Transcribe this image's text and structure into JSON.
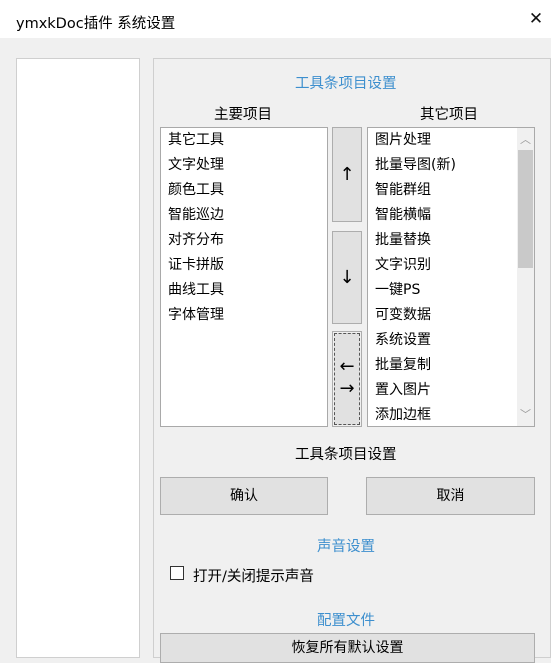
{
  "window": {
    "title": "ymxkDoc插件 系统设置",
    "close_glyph": "✕"
  },
  "toolbar_section": {
    "heading": "工具条项目设置",
    "main_header": "主要项目",
    "other_header": "其它项目",
    "main_items": [
      "其它工具",
      "文字处理",
      "颜色工具",
      "智能巡边",
      "对齐分布",
      "证卡拼版",
      "曲线工具",
      "字体管理"
    ],
    "other_items": [
      "图片处理",
      "批量导图(新)",
      "智能群组",
      "智能横幅",
      "批量替换",
      "文字识别",
      "一键PS",
      "可变数据",
      "系统设置",
      "批量复制",
      "置入图片",
      "添加边框"
    ],
    "up_glyph": "↑",
    "down_glyph": "↓",
    "swap_glyph_left": "←",
    "swap_glyph_right": "→",
    "footer_label": "工具条项目设置",
    "confirm_label": "确认",
    "cancel_label": "取消"
  },
  "sound_section": {
    "heading": "声音设置",
    "checkbox_label": "打开/关闭提示声音",
    "checked": false
  },
  "config_section": {
    "heading": "配置文件",
    "button_label": "恢复所有默认设置"
  },
  "colors": {
    "accent": "#3d8fce",
    "background": "#f0f0f0"
  }
}
